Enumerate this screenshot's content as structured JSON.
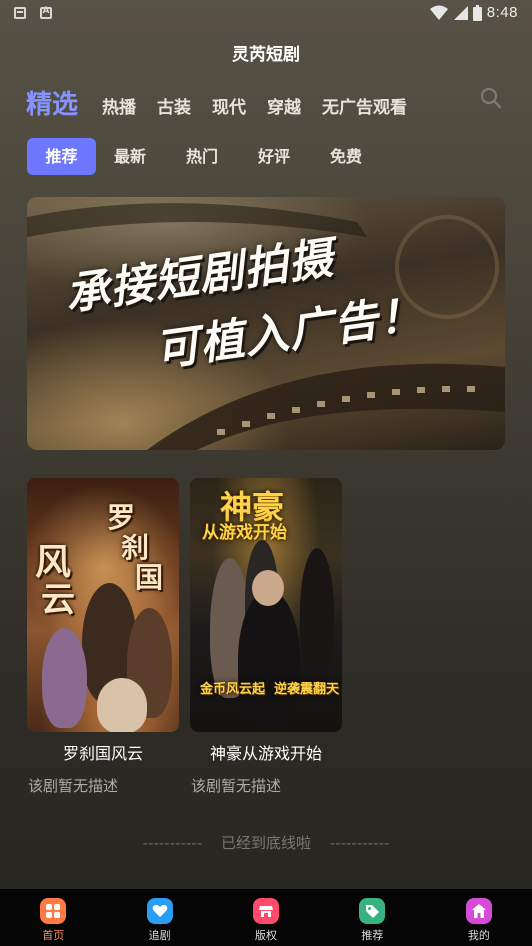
{
  "status_bar": {
    "time": "8:48",
    "left_icons": [
      "mail-icon",
      "a-icon"
    ],
    "right_icons": [
      "wifi-icon",
      "signal-icon",
      "battery-icon"
    ]
  },
  "app": {
    "title": "灵芮短剧"
  },
  "main_tabs": [
    {
      "label": "精选",
      "active": true
    },
    {
      "label": "热播"
    },
    {
      "label": "古装"
    },
    {
      "label": "现代"
    },
    {
      "label": "穿越"
    },
    {
      "label": "无广告观看"
    }
  ],
  "sub_tabs": [
    {
      "label": "推荐",
      "active": true
    },
    {
      "label": "最新"
    },
    {
      "label": "热门"
    },
    {
      "label": "好评"
    },
    {
      "label": "免费"
    }
  ],
  "banner": {
    "line1": "承接短剧拍摄",
    "line2": "可植入广告！"
  },
  "dramas": [
    {
      "title": "罗刹国风云",
      "desc": "该剧暂无描述",
      "poster_text": [
        "风",
        "云",
        "罗",
        "刹",
        "国"
      ]
    },
    {
      "title": "神豪从游戏开始",
      "desc": "该剧暂无描述",
      "poster_text": [
        "神豪",
        "从游戏开始",
        "金币风云起",
        "逆袭震翻天"
      ]
    }
  ],
  "footer": {
    "end_text": "已经到底线啦",
    "dashes": "-----------"
  },
  "bottom_nav": [
    {
      "label": "首页",
      "icon": "home-grid-icon",
      "color": "#ff7a45",
      "active": true
    },
    {
      "label": "追剧",
      "icon": "heart-icon",
      "color": "#2a9df4"
    },
    {
      "label": "版权",
      "icon": "shop-icon",
      "color": "#ff4a6b"
    },
    {
      "label": "推荐",
      "icon": "tag-icon",
      "color": "#36b37e"
    },
    {
      "label": "我的",
      "icon": "house-icon",
      "color": "#d54ad6"
    }
  ],
  "colors": {
    "accent": "#8794ff",
    "sub_tab_active": "#6e77ff",
    "nav_active": "#ff8c55"
  }
}
